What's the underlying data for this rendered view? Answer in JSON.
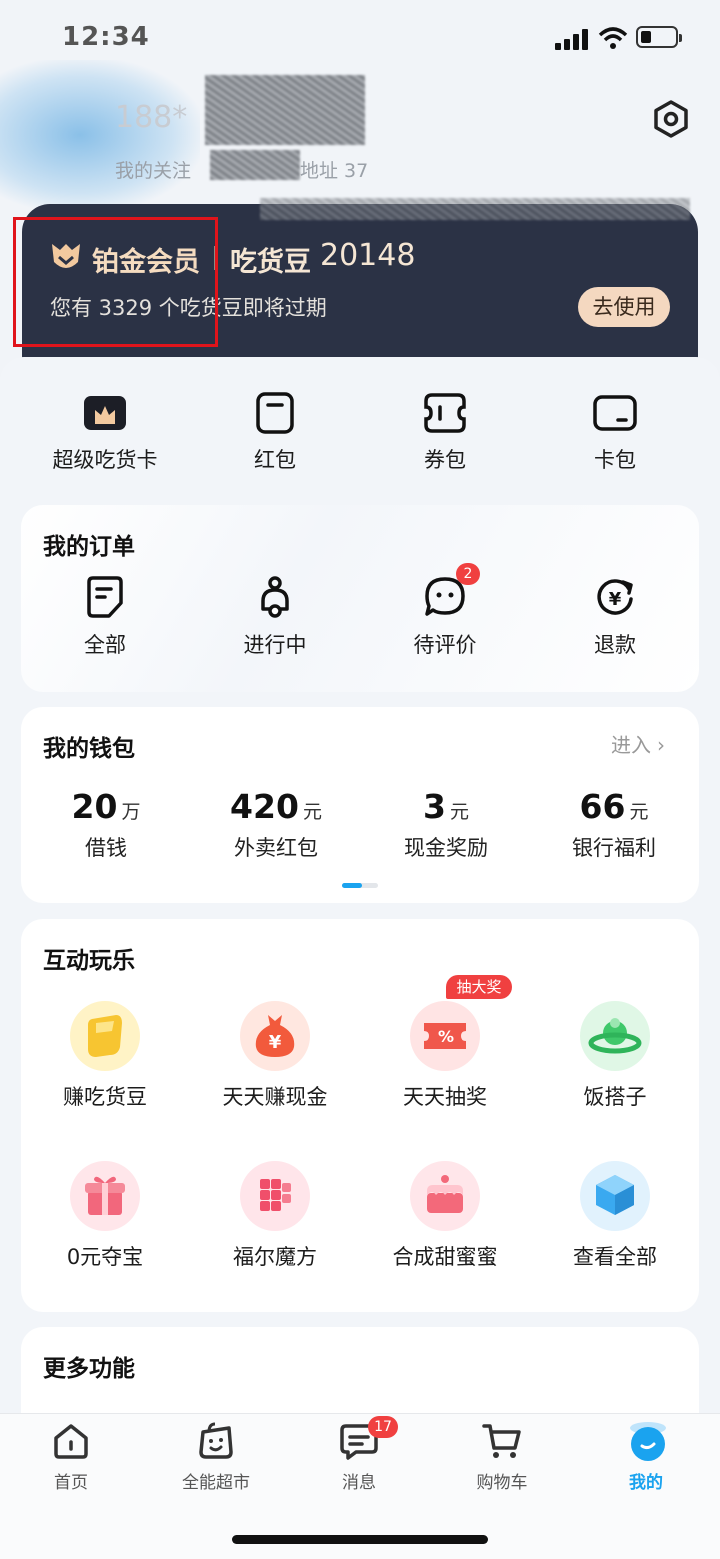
{
  "status_bar": {
    "time": "12:34"
  },
  "header": {
    "user_name": "188*",
    "user_sub": "我的关注",
    "user_sub_tail": "地址 37"
  },
  "member": {
    "title": "铂金会员",
    "beans_label": "吃货豆",
    "beans_value": "20148",
    "notice": "您有 3329 个吃货豆即将过期",
    "use_button": "去使用"
  },
  "quick_actions": [
    {
      "label": "超级吃货卡",
      "icon": "crown-card-icon"
    },
    {
      "label": "红包",
      "icon": "red-packet-icon"
    },
    {
      "label": "券包",
      "icon": "coupon-icon"
    },
    {
      "label": "卡包",
      "icon": "card-wallet-icon"
    }
  ],
  "orders": {
    "title": "我的订单",
    "items": [
      {
        "label": "全部",
        "icon": "order-list-icon"
      },
      {
        "label": "进行中",
        "icon": "scooter-icon"
      },
      {
        "label": "待评价",
        "icon": "comment-icon",
        "badge": "2"
      },
      {
        "label": "退款",
        "icon": "refund-icon"
      }
    ]
  },
  "wallet": {
    "title": "我的钱包",
    "enter": "进入",
    "items": [
      {
        "value": "20",
        "unit": "万",
        "label": "借钱"
      },
      {
        "value": "420",
        "unit": "元",
        "label": "外卖红包"
      },
      {
        "value": "3",
        "unit": "元",
        "label": "现金奖励"
      },
      {
        "value": "66",
        "unit": "元",
        "label": "银行福利"
      }
    ]
  },
  "fun": {
    "title": "互动玩乐",
    "promo_badge": "抽大奖",
    "items": [
      {
        "label": "赚吃货豆",
        "icon": "bean-icon",
        "color": "#f7c531"
      },
      {
        "label": "天天赚现金",
        "icon": "money-bag-icon",
        "color": "#f25a3c"
      },
      {
        "label": "天天抽奖",
        "icon": "lottery-ticket-icon",
        "color": "#f0574b"
      },
      {
        "label": "饭搭子",
        "icon": "planet-icon",
        "color": "#3fc86a"
      },
      {
        "label": "0元夺宝",
        "icon": "gift-box-icon",
        "color": "#f2677c"
      },
      {
        "label": "福尔魔方",
        "icon": "magic-cube-icon",
        "color": "#f04f6a"
      },
      {
        "label": "合成甜蜜蜜",
        "icon": "cake-icon",
        "color": "#f3697a"
      },
      {
        "label": "查看全部",
        "icon": "cube-icon",
        "color": "#3aa9f0"
      }
    ]
  },
  "more": {
    "title": "更多功能"
  },
  "tabbar": [
    {
      "label": "首页",
      "icon": "home-icon"
    },
    {
      "label": "全能超市",
      "icon": "shopping-bag-icon"
    },
    {
      "label": "消息",
      "icon": "message-icon",
      "badge": "17"
    },
    {
      "label": "购物车",
      "icon": "cart-icon"
    },
    {
      "label": "我的",
      "icon": "profile-icon",
      "active": true
    }
  ],
  "colors": {
    "accent": "#1aa3ef",
    "member_card": "#2b3245",
    "badge": "#f04040"
  }
}
